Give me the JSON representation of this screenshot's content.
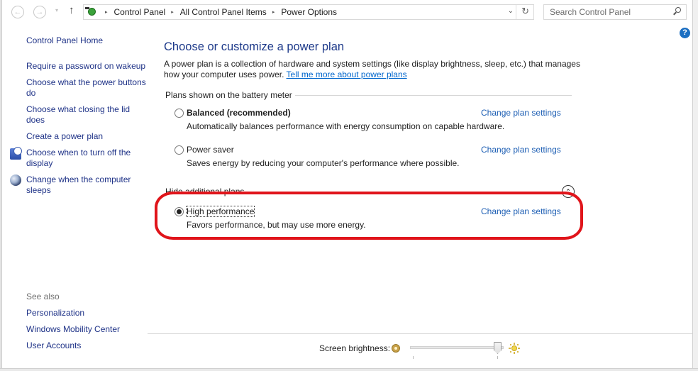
{
  "navigation": {
    "back_icon": "back-arrow-icon",
    "forward_icon": "forward-arrow-icon",
    "recent_icon": "chevron-down-icon",
    "up_icon": "up-arrow-icon",
    "back_glyph": "←",
    "forward_glyph": "→",
    "recent_glyph": "▾",
    "up_glyph": "↑",
    "address_icon": "power-options-icon",
    "breadcrumb": [
      "Control Panel",
      "All Control Panel Items",
      "Power Options"
    ],
    "separator_glyph": "▸",
    "dropdown_glyph": "⌄",
    "refresh_glyph": "↻",
    "search": {
      "placeholder": "Search Control Panel",
      "value": ""
    },
    "help_glyph": "?"
  },
  "sidebar": {
    "home": "Control Panel Home",
    "tasks": [
      {
        "label": "Require a password on wakeup",
        "icon": null
      },
      {
        "label": "Choose what the power buttons do",
        "icon": null
      },
      {
        "label": "Choose what closing the lid does",
        "icon": null
      },
      {
        "label": "Create a power plan",
        "icon": null
      },
      {
        "label": "Choose when to turn off the display",
        "icon": "display-clock-icon"
      },
      {
        "label": "Change when the computer sleeps",
        "icon": "sleep-moon-icon"
      }
    ],
    "see_also_label": "See also",
    "see_also": [
      "Personalization",
      "Windows Mobility Center",
      "User Accounts"
    ]
  },
  "main": {
    "title": "Choose or customize a power plan",
    "description": "A power plan is a collection of hardware and system settings (like display brightness, sleep, etc.) that manages how your computer uses power. ",
    "description_link": "Tell me more about power plans",
    "battery_group_label": "Plans shown on the battery meter",
    "hidden_group_label": "Hide additional plans",
    "collapse_glyph": "⌃",
    "plans": [
      {
        "name": "Balanced (recommended)",
        "description": "Automatically balances performance with energy consumption on capable hardware.",
        "selected": false,
        "bold": true,
        "link": "Change plan settings"
      },
      {
        "name": "Power saver",
        "description": "Saves energy by reducing your computer's performance where possible.",
        "selected": false,
        "bold": false,
        "link": "Change plan settings"
      },
      {
        "name": "High performance",
        "description": "Favors performance, but may use more energy.",
        "selected": true,
        "bold": false,
        "link": "Change plan settings"
      }
    ],
    "annotation_color": "#e0151b"
  },
  "footer": {
    "brightness_label": "Screen brightness:",
    "brightness_percent": 100
  },
  "colors": {
    "title_blue": "#1e3a8a",
    "link_blue": "#1e5fb4",
    "sidebar_link": "#1e3287",
    "help_blue": "#1c6fc2"
  }
}
